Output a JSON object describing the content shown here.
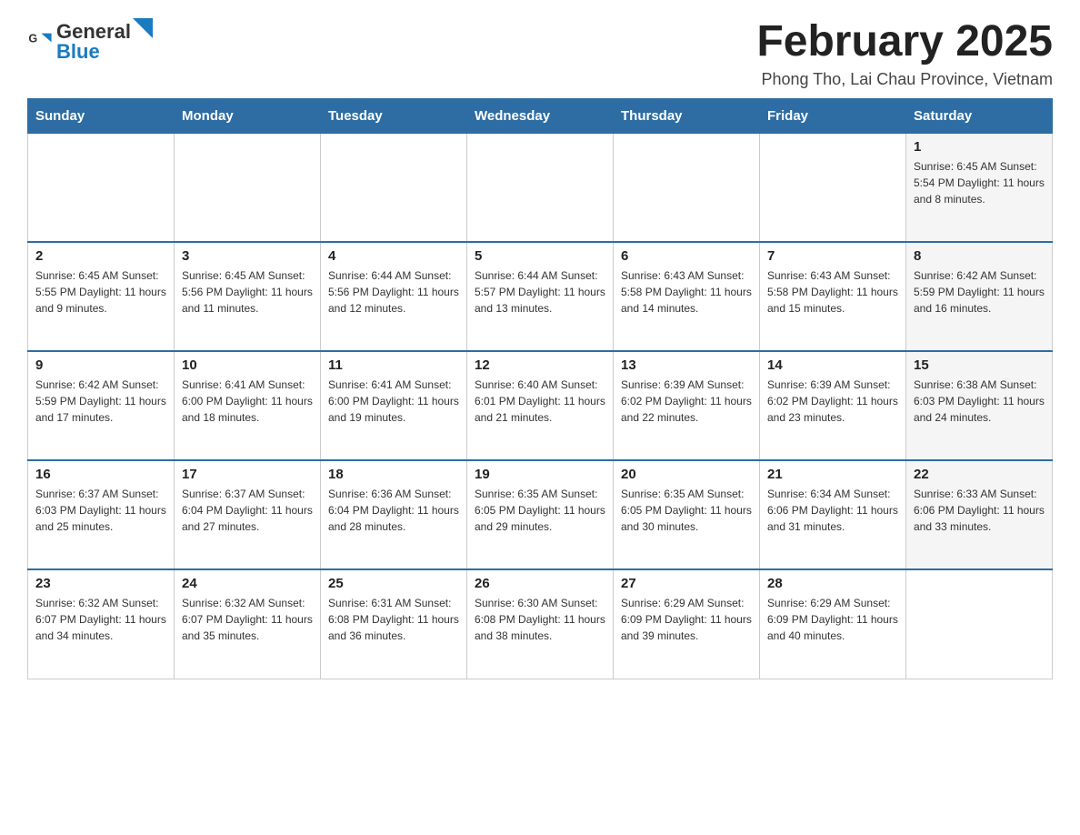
{
  "logo": {
    "general": "General",
    "blue": "Blue"
  },
  "header": {
    "title": "February 2025",
    "location": "Phong Tho, Lai Chau Province, Vietnam"
  },
  "days_of_week": [
    "Sunday",
    "Monday",
    "Tuesday",
    "Wednesday",
    "Thursday",
    "Friday",
    "Saturday"
  ],
  "weeks": [
    {
      "days": [
        {
          "num": "",
          "info": ""
        },
        {
          "num": "",
          "info": ""
        },
        {
          "num": "",
          "info": ""
        },
        {
          "num": "",
          "info": ""
        },
        {
          "num": "",
          "info": ""
        },
        {
          "num": "",
          "info": ""
        },
        {
          "num": "1",
          "info": "Sunrise: 6:45 AM\nSunset: 5:54 PM\nDaylight: 11 hours and 8 minutes."
        }
      ]
    },
    {
      "days": [
        {
          "num": "2",
          "info": "Sunrise: 6:45 AM\nSunset: 5:55 PM\nDaylight: 11 hours and 9 minutes."
        },
        {
          "num": "3",
          "info": "Sunrise: 6:45 AM\nSunset: 5:56 PM\nDaylight: 11 hours and 11 minutes."
        },
        {
          "num": "4",
          "info": "Sunrise: 6:44 AM\nSunset: 5:56 PM\nDaylight: 11 hours and 12 minutes."
        },
        {
          "num": "5",
          "info": "Sunrise: 6:44 AM\nSunset: 5:57 PM\nDaylight: 11 hours and 13 minutes."
        },
        {
          "num": "6",
          "info": "Sunrise: 6:43 AM\nSunset: 5:58 PM\nDaylight: 11 hours and 14 minutes."
        },
        {
          "num": "7",
          "info": "Sunrise: 6:43 AM\nSunset: 5:58 PM\nDaylight: 11 hours and 15 minutes."
        },
        {
          "num": "8",
          "info": "Sunrise: 6:42 AM\nSunset: 5:59 PM\nDaylight: 11 hours and 16 minutes."
        }
      ]
    },
    {
      "days": [
        {
          "num": "9",
          "info": "Sunrise: 6:42 AM\nSunset: 5:59 PM\nDaylight: 11 hours and 17 minutes."
        },
        {
          "num": "10",
          "info": "Sunrise: 6:41 AM\nSunset: 6:00 PM\nDaylight: 11 hours and 18 minutes."
        },
        {
          "num": "11",
          "info": "Sunrise: 6:41 AM\nSunset: 6:00 PM\nDaylight: 11 hours and 19 minutes."
        },
        {
          "num": "12",
          "info": "Sunrise: 6:40 AM\nSunset: 6:01 PM\nDaylight: 11 hours and 21 minutes."
        },
        {
          "num": "13",
          "info": "Sunrise: 6:39 AM\nSunset: 6:02 PM\nDaylight: 11 hours and 22 minutes."
        },
        {
          "num": "14",
          "info": "Sunrise: 6:39 AM\nSunset: 6:02 PM\nDaylight: 11 hours and 23 minutes."
        },
        {
          "num": "15",
          "info": "Sunrise: 6:38 AM\nSunset: 6:03 PM\nDaylight: 11 hours and 24 minutes."
        }
      ]
    },
    {
      "days": [
        {
          "num": "16",
          "info": "Sunrise: 6:37 AM\nSunset: 6:03 PM\nDaylight: 11 hours and 25 minutes."
        },
        {
          "num": "17",
          "info": "Sunrise: 6:37 AM\nSunset: 6:04 PM\nDaylight: 11 hours and 27 minutes."
        },
        {
          "num": "18",
          "info": "Sunrise: 6:36 AM\nSunset: 6:04 PM\nDaylight: 11 hours and 28 minutes."
        },
        {
          "num": "19",
          "info": "Sunrise: 6:35 AM\nSunset: 6:05 PM\nDaylight: 11 hours and 29 minutes."
        },
        {
          "num": "20",
          "info": "Sunrise: 6:35 AM\nSunset: 6:05 PM\nDaylight: 11 hours and 30 minutes."
        },
        {
          "num": "21",
          "info": "Sunrise: 6:34 AM\nSunset: 6:06 PM\nDaylight: 11 hours and 31 minutes."
        },
        {
          "num": "22",
          "info": "Sunrise: 6:33 AM\nSunset: 6:06 PM\nDaylight: 11 hours and 33 minutes."
        }
      ]
    },
    {
      "days": [
        {
          "num": "23",
          "info": "Sunrise: 6:32 AM\nSunset: 6:07 PM\nDaylight: 11 hours and 34 minutes."
        },
        {
          "num": "24",
          "info": "Sunrise: 6:32 AM\nSunset: 6:07 PM\nDaylight: 11 hours and 35 minutes."
        },
        {
          "num": "25",
          "info": "Sunrise: 6:31 AM\nSunset: 6:08 PM\nDaylight: 11 hours and 36 minutes."
        },
        {
          "num": "26",
          "info": "Sunrise: 6:30 AM\nSunset: 6:08 PM\nDaylight: 11 hours and 38 minutes."
        },
        {
          "num": "27",
          "info": "Sunrise: 6:29 AM\nSunset: 6:09 PM\nDaylight: 11 hours and 39 minutes."
        },
        {
          "num": "28",
          "info": "Sunrise: 6:29 AM\nSunset: 6:09 PM\nDaylight: 11 hours and 40 minutes."
        },
        {
          "num": "",
          "info": ""
        }
      ]
    }
  ]
}
